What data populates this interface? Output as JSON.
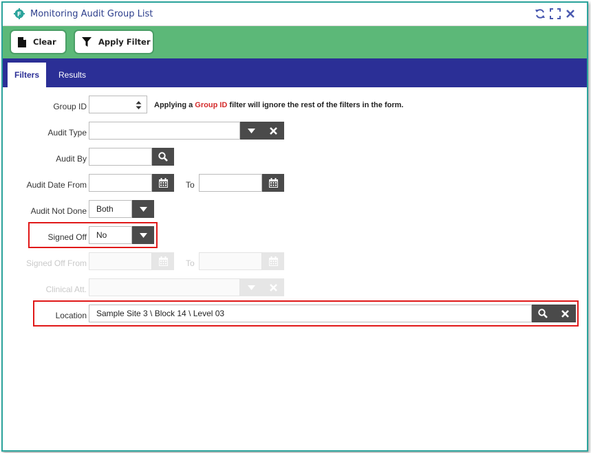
{
  "window": {
    "title": "Monitoring Audit Group List"
  },
  "toolbar": {
    "clear_label": "Clear",
    "apply_label": "Apply Filter"
  },
  "tabs": [
    {
      "label": "Filters",
      "active": true
    },
    {
      "label": "Results",
      "active": false
    }
  ],
  "form": {
    "group_id": {
      "label": "Group ID",
      "value": ""
    },
    "hint": {
      "prefix": "Applying a",
      "highlight": "Group ID",
      "suffix": "filter will ignore the rest of the filters in the form."
    },
    "audit_type": {
      "label": "Audit Type",
      "value": ""
    },
    "audit_by": {
      "label": "Audit By",
      "value": ""
    },
    "audit_date_from": {
      "label": "Audit Date From",
      "value": ""
    },
    "audit_date_to": {
      "label": "To",
      "value": ""
    },
    "audit_not_done": {
      "label": "Audit Not Done",
      "value": "Both"
    },
    "signed_off": {
      "label": "Signed Off",
      "value": "No"
    },
    "signed_off_from": {
      "label": "Signed Off From",
      "value": ""
    },
    "signed_off_to": {
      "label": "To",
      "value": ""
    },
    "clinical_att": {
      "label": "Clinical Att.",
      "value": ""
    },
    "location": {
      "label": "Location",
      "value": "Sample Site 3 \\ Block 14 \\ Level 03"
    }
  },
  "colors": {
    "accent_green": "#5cb878",
    "tab_bar": "#2b2f96",
    "highlight_red": "#e01818",
    "title_text": "#2c3e8c"
  },
  "icons": [
    "app-gear-icon",
    "refresh-icon",
    "maximize-icon",
    "close-icon",
    "document-icon",
    "filter-icon",
    "spinner-icon",
    "chevron-down-icon",
    "clear-x-icon",
    "search-icon",
    "calendar-icon"
  ]
}
